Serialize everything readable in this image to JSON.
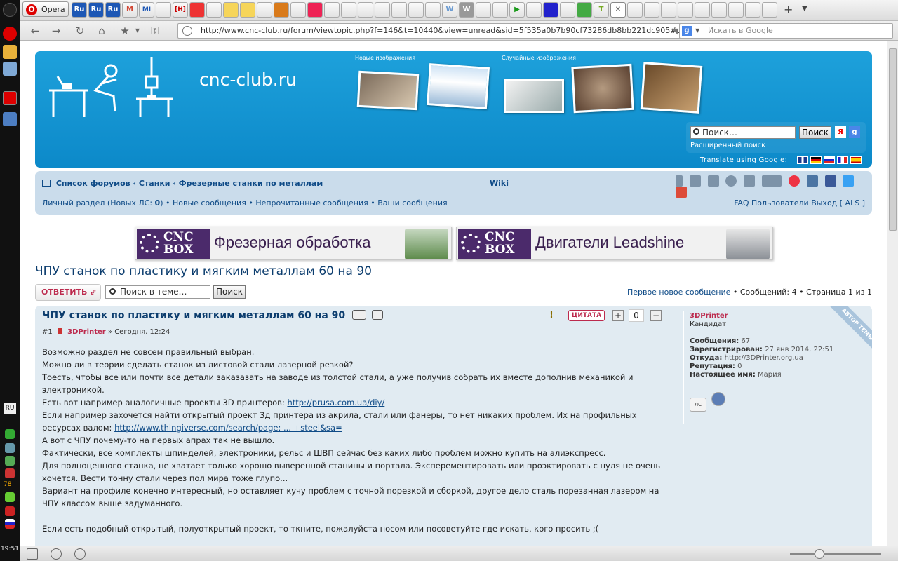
{
  "browser": {
    "menu_label": "Opera",
    "url": "http://www.cnc-club.ru/forum/viewtopic.php?f=146&t=10440&view=unread&sid=5f535a0b7b90cf73286db8bb221dc905#unread",
    "search_placeholder": "Искать в Google",
    "ru_tab": "Ru",
    "tab_h": "[H]",
    "tab_m": "M",
    "tab_mi": "MI",
    "tab_w": "W",
    "tab_t": "T",
    "lang": "RU",
    "tray_count": "78",
    "clock": "19:51"
  },
  "header": {
    "site_name": "cnc-club.ru",
    "new_images": "Новые изображения",
    "random_images": "Случайные изображения",
    "search_placeholder": "Поиск…",
    "search_button": "Поиск",
    "yandex": "Я",
    "google": "g",
    "advanced_search": "Расширенный поиск",
    "translate": "Translate using Google:"
  },
  "nav": {
    "crumb_home": "Список форумов",
    "crumb_sep": "‹",
    "crumb_machines": "Станки",
    "crumb_mills": "Фрезерные станки по металлам",
    "wiki": "Wiki",
    "personal": "Личный раздел (Новых ЛС: ",
    "pm_count": "0",
    "personal_close": ")",
    "dot": "•",
    "new_posts": "Новые сообщения",
    "unread": "Непрочитанные сообщения",
    "your_posts": "Ваши сообщения",
    "faq": "FAQ",
    "users": "Пользователи",
    "logout": "Выход [ ALS ]"
  },
  "banners": [
    {
      "l1": "CNC",
      "l2": "BOX",
      "text": "Фрезерная обработка"
    },
    {
      "l1": "CNC",
      "l2": "BOX",
      "text": "Двигатели Leadshine"
    }
  ],
  "topic": {
    "title": "ЧПУ станок по пластику и мягким металлам 60 на 90",
    "reply": "ОТВЕТИТЬ",
    "reply_icon": "⇙",
    "search_placeholder": "Поиск в теме…",
    "search_button": "Поиск",
    "first_new": "Первое новое сообщение",
    "messages": "Сообщений: 4",
    "page": "Страница 1 из 1"
  },
  "post": {
    "title": "ЧПУ станок по пластику и мягким металлам 60 на 90",
    "warn": "!",
    "quote": "ЦИТАТА",
    "plus": "+",
    "minus": "−",
    "rating": "0",
    "number": "#1",
    "author": "3DPrinter",
    "separator": "»",
    "date": "Сегодня, 12:24",
    "p1": "Возможно раздел не совсем правильный выбран.",
    "p2": "Можно ли в теории сделать станок из листовой стали лазерной резкой?",
    "p3": "Тоесть, чтобы все или почти все детали заказазать на заводе из толстой стали, а уже получив собрать их вместе дополнив механикой и электроникой.",
    "p4_pre": "Есть вот например аналогичные проекты 3D принтеров: ",
    "p4_link": "http://prusa.com.ua/diy/",
    "p5_pre": "Если например захочется найти открытый проект 3д принтера из акрила, стали или фанеры, то нет никаких проблем. Их на профильных ресурсах валом: ",
    "p5_link": "http://www.thingiverse.com/search/page: ... +steel&sa=",
    "p6": "А вот с ЧПУ почему-то на первых апрах так не вышло.",
    "p7": "Фактически, все комплекты шпинделей, электроники, рельс и ШВП сейчас без каких либо проблем можно купить на алиэкспресс.",
    "p8": "Для полноценного станка, не хватает только хорошо выверенной станины и портала. Эксперементировать или проэктировать с нуля не очень хочется. Вести тонну стали через пол мира тоже глупо...",
    "p9": "Вариант на профиле конечно интересный, но оставляет кучу проблем с точной порезкой и сборкой, другое дело сталь порезанная лазером на ЧПУ классом выше задуманного.",
    "p10": "Если есть подобный открытый, полуоткрытый проект, то ткните, пожалуйста носом или посоветуйте где искать, кого просить ;("
  },
  "profile": {
    "name": "3DPrinter",
    "rank": "Кандидат",
    "posts_label": "Сообщения:",
    "posts": "67",
    "reg_label": "Зарегистрирован:",
    "reg": "27 янв 2014, 22:51",
    "from_label": "Откуда:",
    "from": "http://3DPrinter.org.ua",
    "rep_label": "Репутация:",
    "rep": "0",
    "realname_label": "Настоящее имя:",
    "realname": "Мария",
    "pm_button": "ЛС",
    "ribbon": "АВТОР ТЕМЫ"
  },
  "colors": {
    "header_blue": "#1ea1db",
    "nav_bg": "#cadceb",
    "post_bg": "#e1ebf2",
    "link": "#0f4b87",
    "accent": "#bc2a4d"
  }
}
